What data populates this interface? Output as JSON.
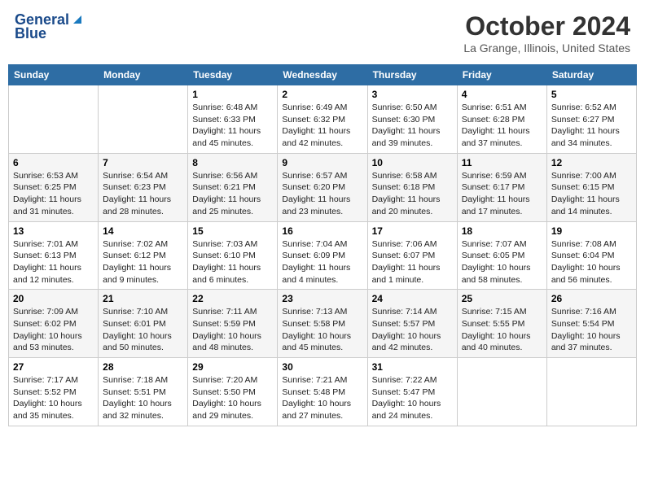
{
  "header": {
    "logo_general": "General",
    "logo_blue": "Blue",
    "month_title": "October 2024",
    "location": "La Grange, Illinois, United States"
  },
  "days_of_week": [
    "Sunday",
    "Monday",
    "Tuesday",
    "Wednesday",
    "Thursday",
    "Friday",
    "Saturday"
  ],
  "weeks": [
    [
      {
        "day": "",
        "content": ""
      },
      {
        "day": "",
        "content": ""
      },
      {
        "day": "1",
        "content": "Sunrise: 6:48 AM\nSunset: 6:33 PM\nDaylight: 11 hours and 45 minutes."
      },
      {
        "day": "2",
        "content": "Sunrise: 6:49 AM\nSunset: 6:32 PM\nDaylight: 11 hours and 42 minutes."
      },
      {
        "day": "3",
        "content": "Sunrise: 6:50 AM\nSunset: 6:30 PM\nDaylight: 11 hours and 39 minutes."
      },
      {
        "day": "4",
        "content": "Sunrise: 6:51 AM\nSunset: 6:28 PM\nDaylight: 11 hours and 37 minutes."
      },
      {
        "day": "5",
        "content": "Sunrise: 6:52 AM\nSunset: 6:27 PM\nDaylight: 11 hours and 34 minutes."
      }
    ],
    [
      {
        "day": "6",
        "content": "Sunrise: 6:53 AM\nSunset: 6:25 PM\nDaylight: 11 hours and 31 minutes."
      },
      {
        "day": "7",
        "content": "Sunrise: 6:54 AM\nSunset: 6:23 PM\nDaylight: 11 hours and 28 minutes."
      },
      {
        "day": "8",
        "content": "Sunrise: 6:56 AM\nSunset: 6:21 PM\nDaylight: 11 hours and 25 minutes."
      },
      {
        "day": "9",
        "content": "Sunrise: 6:57 AM\nSunset: 6:20 PM\nDaylight: 11 hours and 23 minutes."
      },
      {
        "day": "10",
        "content": "Sunrise: 6:58 AM\nSunset: 6:18 PM\nDaylight: 11 hours and 20 minutes."
      },
      {
        "day": "11",
        "content": "Sunrise: 6:59 AM\nSunset: 6:17 PM\nDaylight: 11 hours and 17 minutes."
      },
      {
        "day": "12",
        "content": "Sunrise: 7:00 AM\nSunset: 6:15 PM\nDaylight: 11 hours and 14 minutes."
      }
    ],
    [
      {
        "day": "13",
        "content": "Sunrise: 7:01 AM\nSunset: 6:13 PM\nDaylight: 11 hours and 12 minutes."
      },
      {
        "day": "14",
        "content": "Sunrise: 7:02 AM\nSunset: 6:12 PM\nDaylight: 11 hours and 9 minutes."
      },
      {
        "day": "15",
        "content": "Sunrise: 7:03 AM\nSunset: 6:10 PM\nDaylight: 11 hours and 6 minutes."
      },
      {
        "day": "16",
        "content": "Sunrise: 7:04 AM\nSunset: 6:09 PM\nDaylight: 11 hours and 4 minutes."
      },
      {
        "day": "17",
        "content": "Sunrise: 7:06 AM\nSunset: 6:07 PM\nDaylight: 11 hours and 1 minute."
      },
      {
        "day": "18",
        "content": "Sunrise: 7:07 AM\nSunset: 6:05 PM\nDaylight: 10 hours and 58 minutes."
      },
      {
        "day": "19",
        "content": "Sunrise: 7:08 AM\nSunset: 6:04 PM\nDaylight: 10 hours and 56 minutes."
      }
    ],
    [
      {
        "day": "20",
        "content": "Sunrise: 7:09 AM\nSunset: 6:02 PM\nDaylight: 10 hours and 53 minutes."
      },
      {
        "day": "21",
        "content": "Sunrise: 7:10 AM\nSunset: 6:01 PM\nDaylight: 10 hours and 50 minutes."
      },
      {
        "day": "22",
        "content": "Sunrise: 7:11 AM\nSunset: 5:59 PM\nDaylight: 10 hours and 48 minutes."
      },
      {
        "day": "23",
        "content": "Sunrise: 7:13 AM\nSunset: 5:58 PM\nDaylight: 10 hours and 45 minutes."
      },
      {
        "day": "24",
        "content": "Sunrise: 7:14 AM\nSunset: 5:57 PM\nDaylight: 10 hours and 42 minutes."
      },
      {
        "day": "25",
        "content": "Sunrise: 7:15 AM\nSunset: 5:55 PM\nDaylight: 10 hours and 40 minutes."
      },
      {
        "day": "26",
        "content": "Sunrise: 7:16 AM\nSunset: 5:54 PM\nDaylight: 10 hours and 37 minutes."
      }
    ],
    [
      {
        "day": "27",
        "content": "Sunrise: 7:17 AM\nSunset: 5:52 PM\nDaylight: 10 hours and 35 minutes."
      },
      {
        "day": "28",
        "content": "Sunrise: 7:18 AM\nSunset: 5:51 PM\nDaylight: 10 hours and 32 minutes."
      },
      {
        "day": "29",
        "content": "Sunrise: 7:20 AM\nSunset: 5:50 PM\nDaylight: 10 hours and 29 minutes."
      },
      {
        "day": "30",
        "content": "Sunrise: 7:21 AM\nSunset: 5:48 PM\nDaylight: 10 hours and 27 minutes."
      },
      {
        "day": "31",
        "content": "Sunrise: 7:22 AM\nSunset: 5:47 PM\nDaylight: 10 hours and 24 minutes."
      },
      {
        "day": "",
        "content": ""
      },
      {
        "day": "",
        "content": ""
      }
    ]
  ]
}
